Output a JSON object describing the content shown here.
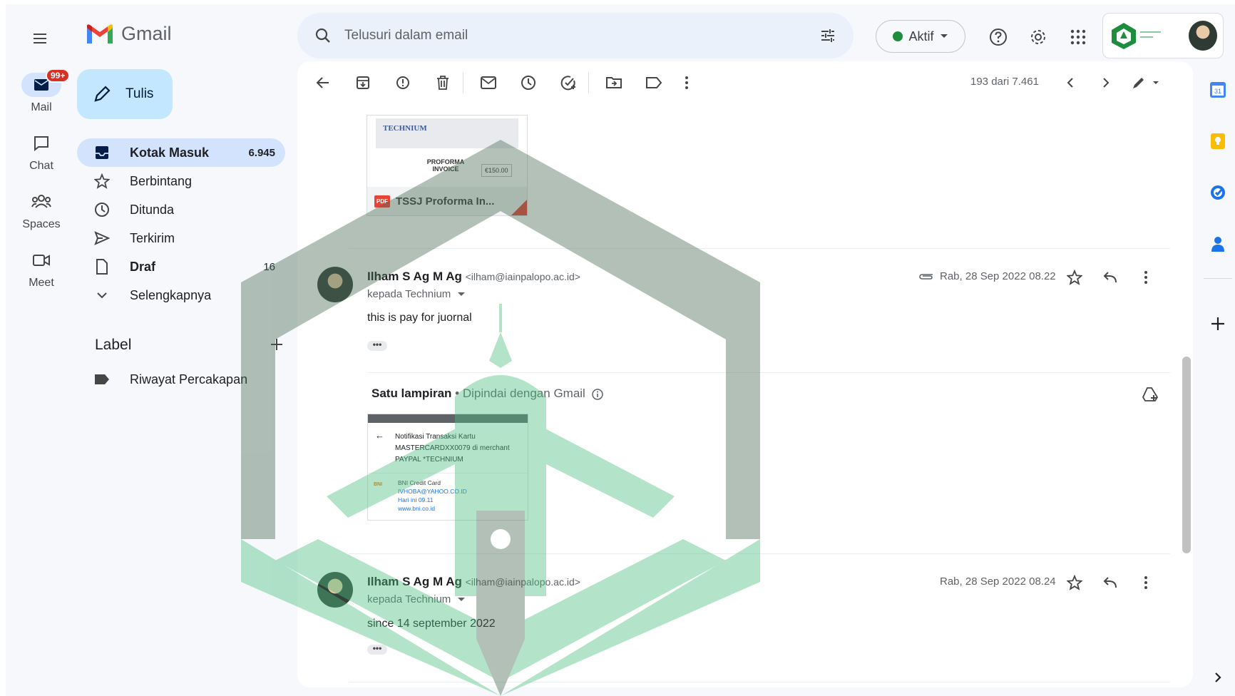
{
  "app": {
    "name": "Gmail"
  },
  "search": {
    "placeholder": "Telusuri dalam email"
  },
  "status": {
    "label": "Aktif"
  },
  "rail": {
    "mail_label": "Mail",
    "mail_badge": "99+",
    "chat_label": "Chat",
    "spaces_label": "Spaces",
    "meet_label": "Meet"
  },
  "compose": {
    "label": "Tulis"
  },
  "nav": {
    "inbox": {
      "label": "Kotak Masuk",
      "count": "6.945"
    },
    "starred": {
      "label": "Berbintang"
    },
    "snoozed": {
      "label": "Ditunda"
    },
    "sent": {
      "label": "Terkirim"
    },
    "drafts": {
      "label": "Draf",
      "count": "16"
    },
    "more": {
      "label": "Selengkapnya"
    }
  },
  "labels": {
    "heading": "Label",
    "items": [
      {
        "label": "Riwayat Percakapan"
      }
    ]
  },
  "pager": {
    "text": "193 dari 7.461"
  },
  "attachment_top": {
    "filename": "TSSJ Proforma In...",
    "type": "PDF",
    "brand": "TECHNIUM",
    "doc_title": "PROFORMA INVOICE",
    "amount": "€150.00"
  },
  "messages": [
    {
      "sender_name": "Ilham S Ag M Ag",
      "sender_email": "<ilham@iainpalopo.ac.id>",
      "to": "kepada Technium",
      "date": "Rab, 28 Sep 2022 08.22",
      "body": "this is pay for juornal",
      "attachment_heading": "Satu lampiran",
      "attachment_note": "Dipindai dengan Gmail",
      "attachment_preview": {
        "title": "Notifikasi Transaksi Kartu MASTERCARDXX0079 di merchant PAYPAL *TECHNIUM",
        "sender": "BNI Credit Card",
        "email": "IVHOBA@YAHOO.CO.ID",
        "time": "Hari ini 09.11",
        "site": "www.bni.co.id"
      }
    },
    {
      "sender_name": "Ilham S Ag M Ag",
      "sender_email": "<ilham@iainpalopo.ac.id>",
      "to": "kepada Technium",
      "date": "Rab, 28 Sep 2022 08.24",
      "body": "since 14 september 2022"
    }
  ],
  "colors": {
    "accent": "#0b57d0",
    "compose_bg": "#c2e7ff",
    "nav_active": "#d3e3fd",
    "watermark_green": "#4dbf80",
    "watermark_gray": "#4a6b55"
  }
}
